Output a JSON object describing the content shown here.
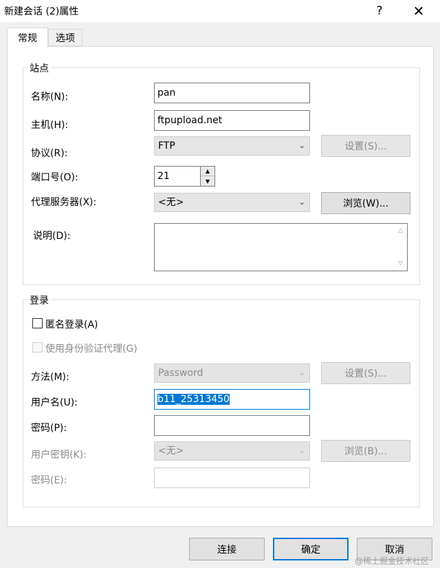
{
  "window": {
    "title": "新建会话 (2)属性",
    "help": "?",
    "close": "✕"
  },
  "tabs": [
    {
      "label": "常规"
    },
    {
      "label": "选项"
    }
  ],
  "site": {
    "group_title": "站点",
    "name_label": "名称(N):",
    "name_value": "pan",
    "host_label": "主机(H):",
    "host_value": "ftpupload.net",
    "protocol_label": "协议(R):",
    "protocol_value": "FTP",
    "protocol_settings": "设置(S)...",
    "port_label": "端口号(O):",
    "port_value": "21",
    "proxy_label": "代理服务器(X):",
    "proxy_value": "<无>",
    "proxy_browse": "浏览(W)...",
    "desc_label": "说明(D):",
    "desc_value": ""
  },
  "login": {
    "group_title": "登录",
    "anonymous_label": "匿名登录(A)",
    "anonymous_checked": false,
    "identity_proxy_label": "使用身份验证代理(G)",
    "identity_proxy_checked": false,
    "method_label": "方法(M):",
    "method_value": "Password",
    "method_settings": "设置(S)...",
    "username_label": "用户名(U):",
    "username_value": "b11_25313450",
    "password_label": "密码(P):",
    "password_value": "",
    "user_key_label": "用户密钥(K):",
    "user_key_value": "<无>",
    "user_key_browse": "浏览(B)...",
    "passphrase_label": "密码(E):",
    "passphrase_value": ""
  },
  "footer": {
    "connect": "连接",
    "ok": "确定",
    "cancel": "取消"
  },
  "watermark": "@稀土掘金技术社区",
  "colors": {
    "accent": "#0078d7",
    "disabled_text": "#8c8c8c"
  }
}
